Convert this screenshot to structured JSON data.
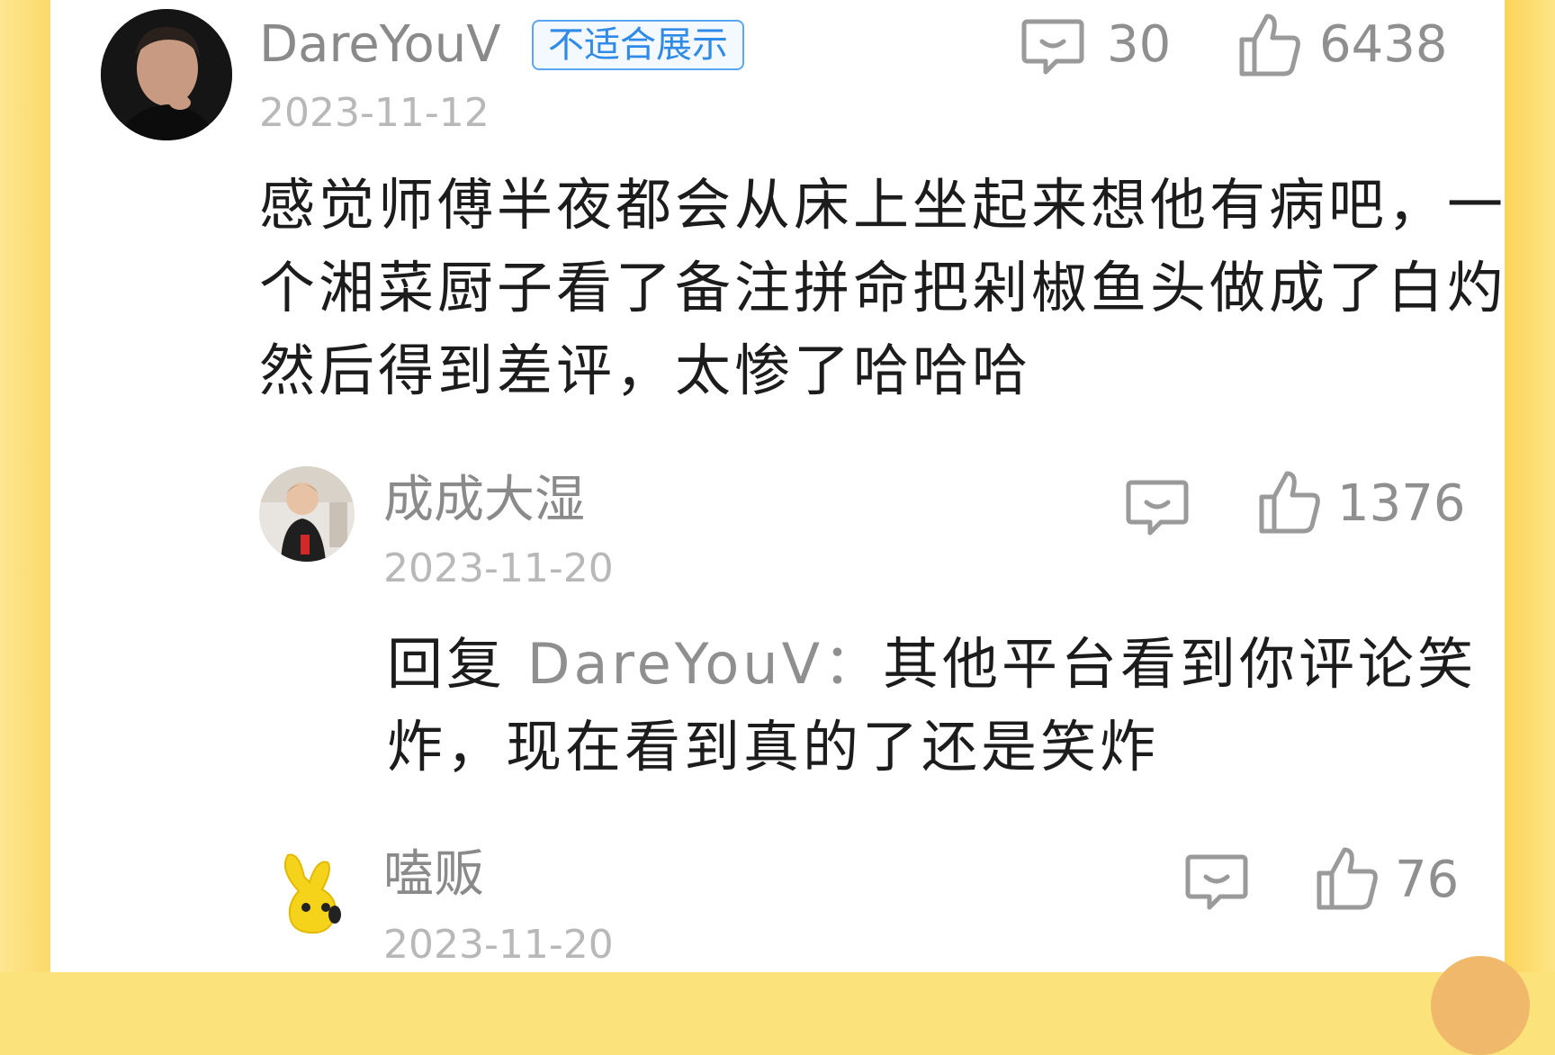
{
  "comments": [
    {
      "user": "DareYouV",
      "badge": "不适合展示",
      "date": "2023-11-12",
      "reply_count": "30",
      "like_count": "6438",
      "text": "感觉师傅半夜都会从床上坐起来想他有病吧，一个湘菜厨子看了备注拼命把剁椒鱼头做成了白灼然后得到差评，太惨了哈哈哈"
    },
    {
      "user": "成成大湿",
      "date": "2023-11-20",
      "like_count": "1376",
      "reply_prefix": "回复",
      "reply_to": "DareYouV：",
      "text": "其他平台看到你评论笑炸，现在看到真的了还是笑炸"
    },
    {
      "user": "嗑贩",
      "date": "2023-11-20",
      "like_count": "76"
    }
  ],
  "icons": {
    "comment": "comment-bubble-icon",
    "like": "thumbs-up-icon"
  },
  "colors": {
    "side_yellow": "#fcd96a",
    "badge_blue": "#2f8ae8",
    "text": "#1c1c1c",
    "meta_gray": "#8a8a8a"
  }
}
